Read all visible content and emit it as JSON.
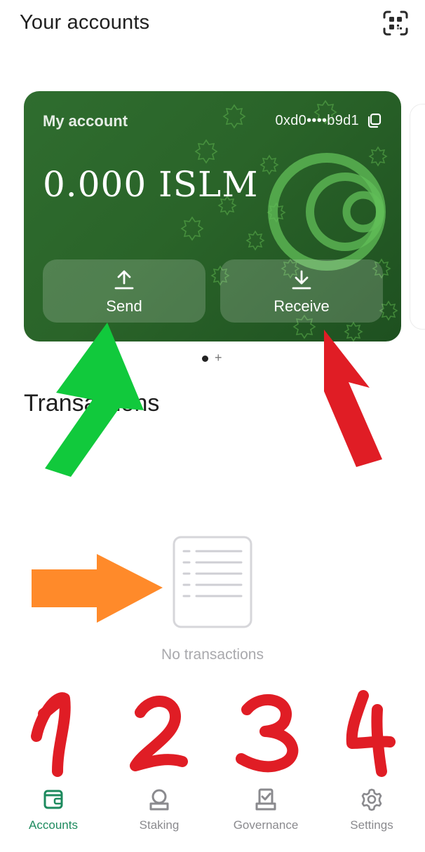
{
  "header": {
    "title": "Your accounts"
  },
  "card": {
    "label": "My account",
    "address": "0xd0••••b9d1",
    "balance": "0.000 ISLM",
    "send_label": "Send",
    "receive_label": "Receive"
  },
  "pager": {
    "active_index": 0,
    "add_symbol": "+"
  },
  "transactions": {
    "title": "Transactions",
    "empty_text": "No transactions"
  },
  "annotations": {
    "numbers": [
      "1",
      "2",
      "3",
      "4"
    ],
    "colors": {
      "green_arrow": "#11c93c",
      "red": "#e01d25",
      "orange_arrow": "#ff8a2a"
    }
  },
  "tabs": [
    {
      "label": "Accounts",
      "icon": "wallet-icon",
      "active": true
    },
    {
      "label": "Staking",
      "icon": "staking-icon",
      "active": false
    },
    {
      "label": "Governance",
      "icon": "governance-icon",
      "active": false
    },
    {
      "label": "Settings",
      "icon": "gear-icon",
      "active": false
    }
  ],
  "colors": {
    "card_green": "#2a6429",
    "accent_green": "#1d8a5e",
    "tab_inactive": "#8a8a8e"
  }
}
